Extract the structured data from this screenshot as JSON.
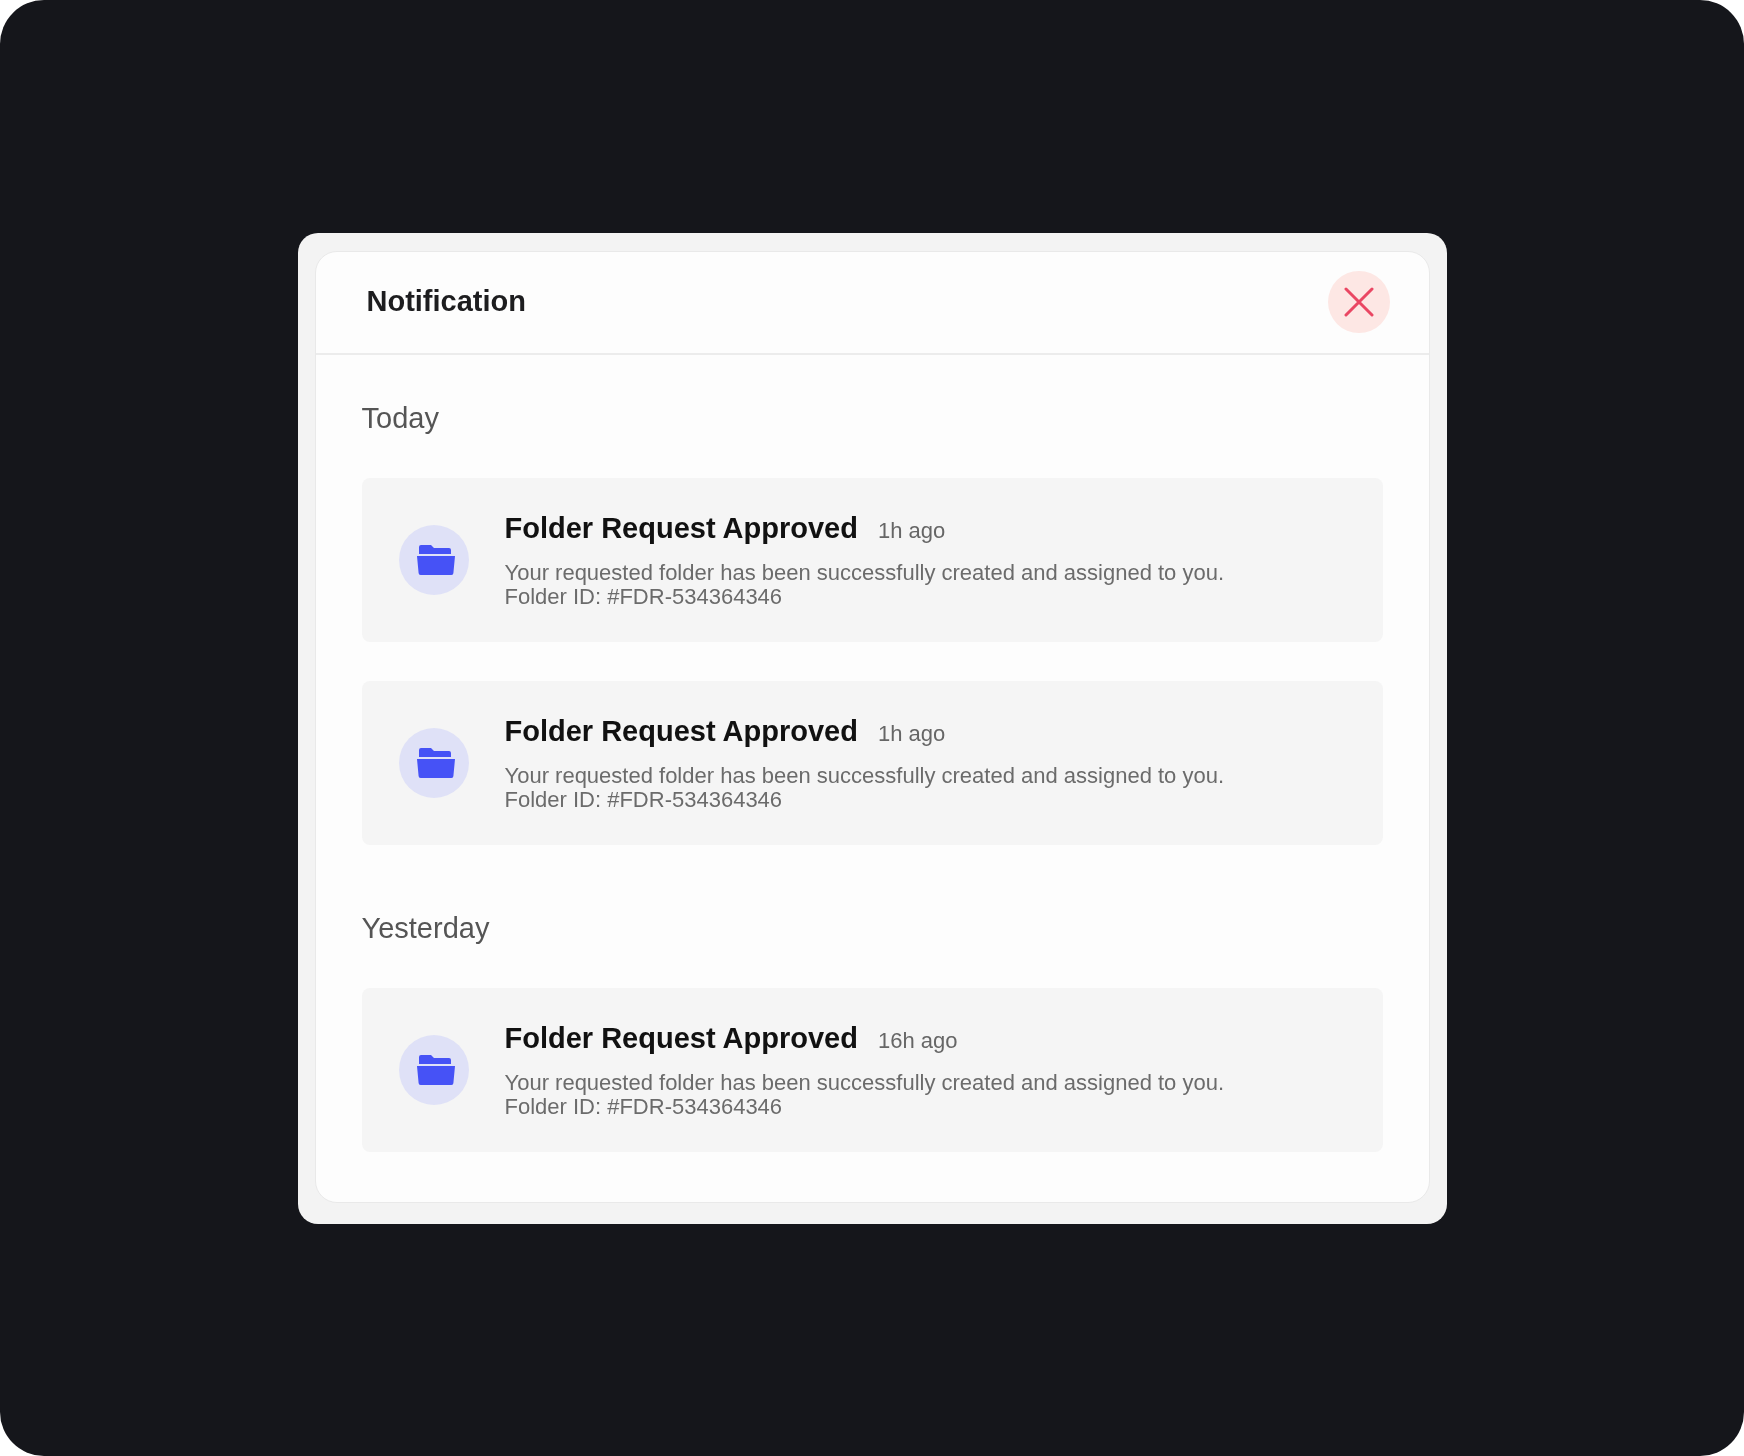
{
  "dialog": {
    "title": "Notification"
  },
  "sections": [
    {
      "heading": "Today",
      "notifications": [
        {
          "title": "Folder Request Approved",
          "time": "1h ago",
          "message": "Your requested folder has been successfully created and assigned to you.",
          "reference": "Folder ID: #FDR-534364346"
        },
        {
          "title": "Folder Request Approved",
          "time": "1h ago",
          "message": "Your requested folder has been successfully created and assigned to you.",
          "reference": "Folder ID: #FDR-534364346"
        }
      ]
    },
    {
      "heading": "Yesterday",
      "notifications": [
        {
          "title": "Folder Request Approved",
          "time": "16h ago",
          "message": "Your requested folder has been successfully created and assigned to you.",
          "reference": "Folder ID: #FDR-534364346"
        }
      ]
    }
  ]
}
